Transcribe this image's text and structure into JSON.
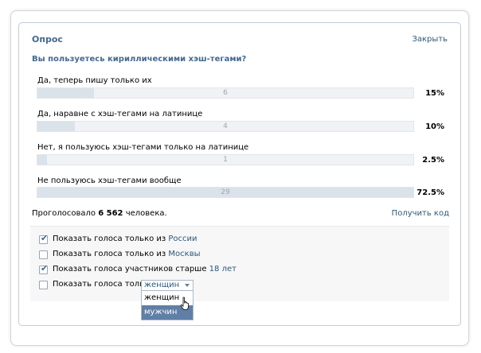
{
  "poll": {
    "title": "Опрос",
    "close_label": "Закрыть",
    "question": "Вы пользуетесь кириллическими хэш-тегами?",
    "options": [
      {
        "label": "Да, теперь пишу только их",
        "count": "6",
        "percent": "15%",
        "fill": 0.15
      },
      {
        "label": "Да, наравне с хэш-тегами на латинице",
        "count": "4",
        "percent": "10%",
        "fill": 0.1
      },
      {
        "label": "Нет, я пользуюсь хэш-тегами только на латинице",
        "count": "1",
        "percent": "2.5%",
        "fill": 0.025
      },
      {
        "label": "Не пользуюсь хэш-тегами вообще",
        "count": "29",
        "percent": "72.5%",
        "fill": 1.0
      }
    ],
    "voted_prefix": "Проголосовало ",
    "voted_count": "6 562",
    "voted_suffix": " человека.",
    "get_code": "Получить код"
  },
  "filters": [
    {
      "text": "Показать голоса только из ",
      "link": "России",
      "checked": true
    },
    {
      "text": "Показать голоса только из ",
      "link": "Москвы",
      "checked": false
    },
    {
      "text": "Показать голоса участников старше ",
      "link": "18 лет",
      "checked": true
    },
    {
      "text": "Показать голоса только",
      "link": "",
      "checked": false
    }
  ],
  "gender_dropdown": {
    "selected": "женщин",
    "options": [
      "женщин",
      "мужчин"
    ],
    "highlighted": "мужчин"
  },
  "colors": {
    "accent": "#45688e",
    "link": "#2b587a",
    "bar_fill": "#dae2ea",
    "menu_highlight": "#5f7fa6"
  }
}
